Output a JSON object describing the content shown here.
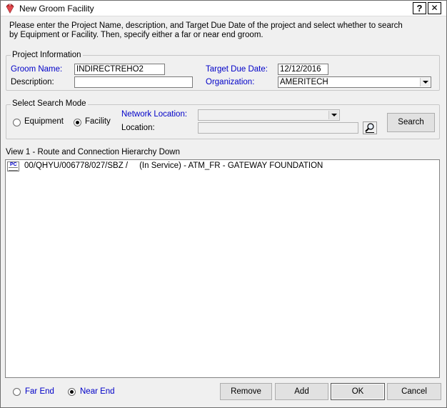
{
  "window": {
    "title": "New Groom Facility",
    "help_label": "?",
    "close_label": "✕"
  },
  "instructions": "Please enter the Project Name, description, and Target Due Date of the project and select whether to search by Equipment or Facility. Then, specify either a far or near end groom.",
  "project_info": {
    "legend": "Project Information",
    "groom_name_label": "Groom Name:",
    "groom_name_value": "INDIRECTREHO2",
    "description_label": "Description:",
    "description_value": "",
    "target_due_date_label": "Target Due Date:",
    "target_due_date_value": "12/12/2016",
    "organization_label": "Organization:",
    "organization_value": "AMERITECH"
  },
  "search_mode": {
    "legend": "Select Search Mode",
    "equipment_label": "Equipment",
    "facility_label": "Facility",
    "selected": "facility",
    "network_location_label": "Network Location:",
    "network_location_value": "",
    "location_label": "Location:",
    "location_value": "",
    "search_button": "Search"
  },
  "view": {
    "title": "View 1 - Route and Connection Hierarchy Down",
    "rows": [
      {
        "icon": "pc-icon",
        "icon_text": "PC",
        "text": "00/QHYU/006778/027/SBZ /     (In Service) - ATM_FR - GATEWAY FOUNDATION"
      }
    ]
  },
  "footer": {
    "far_end_label": "Far End",
    "near_end_label": "Near End",
    "selected": "near_end",
    "remove_button": "Remove",
    "add_button": "Add",
    "ok_button": "OK",
    "cancel_button": "Cancel"
  },
  "colors": {
    "label_blue": "#0000c8",
    "background": "#f0f0f0",
    "icon_ruby": "#c0282d"
  }
}
